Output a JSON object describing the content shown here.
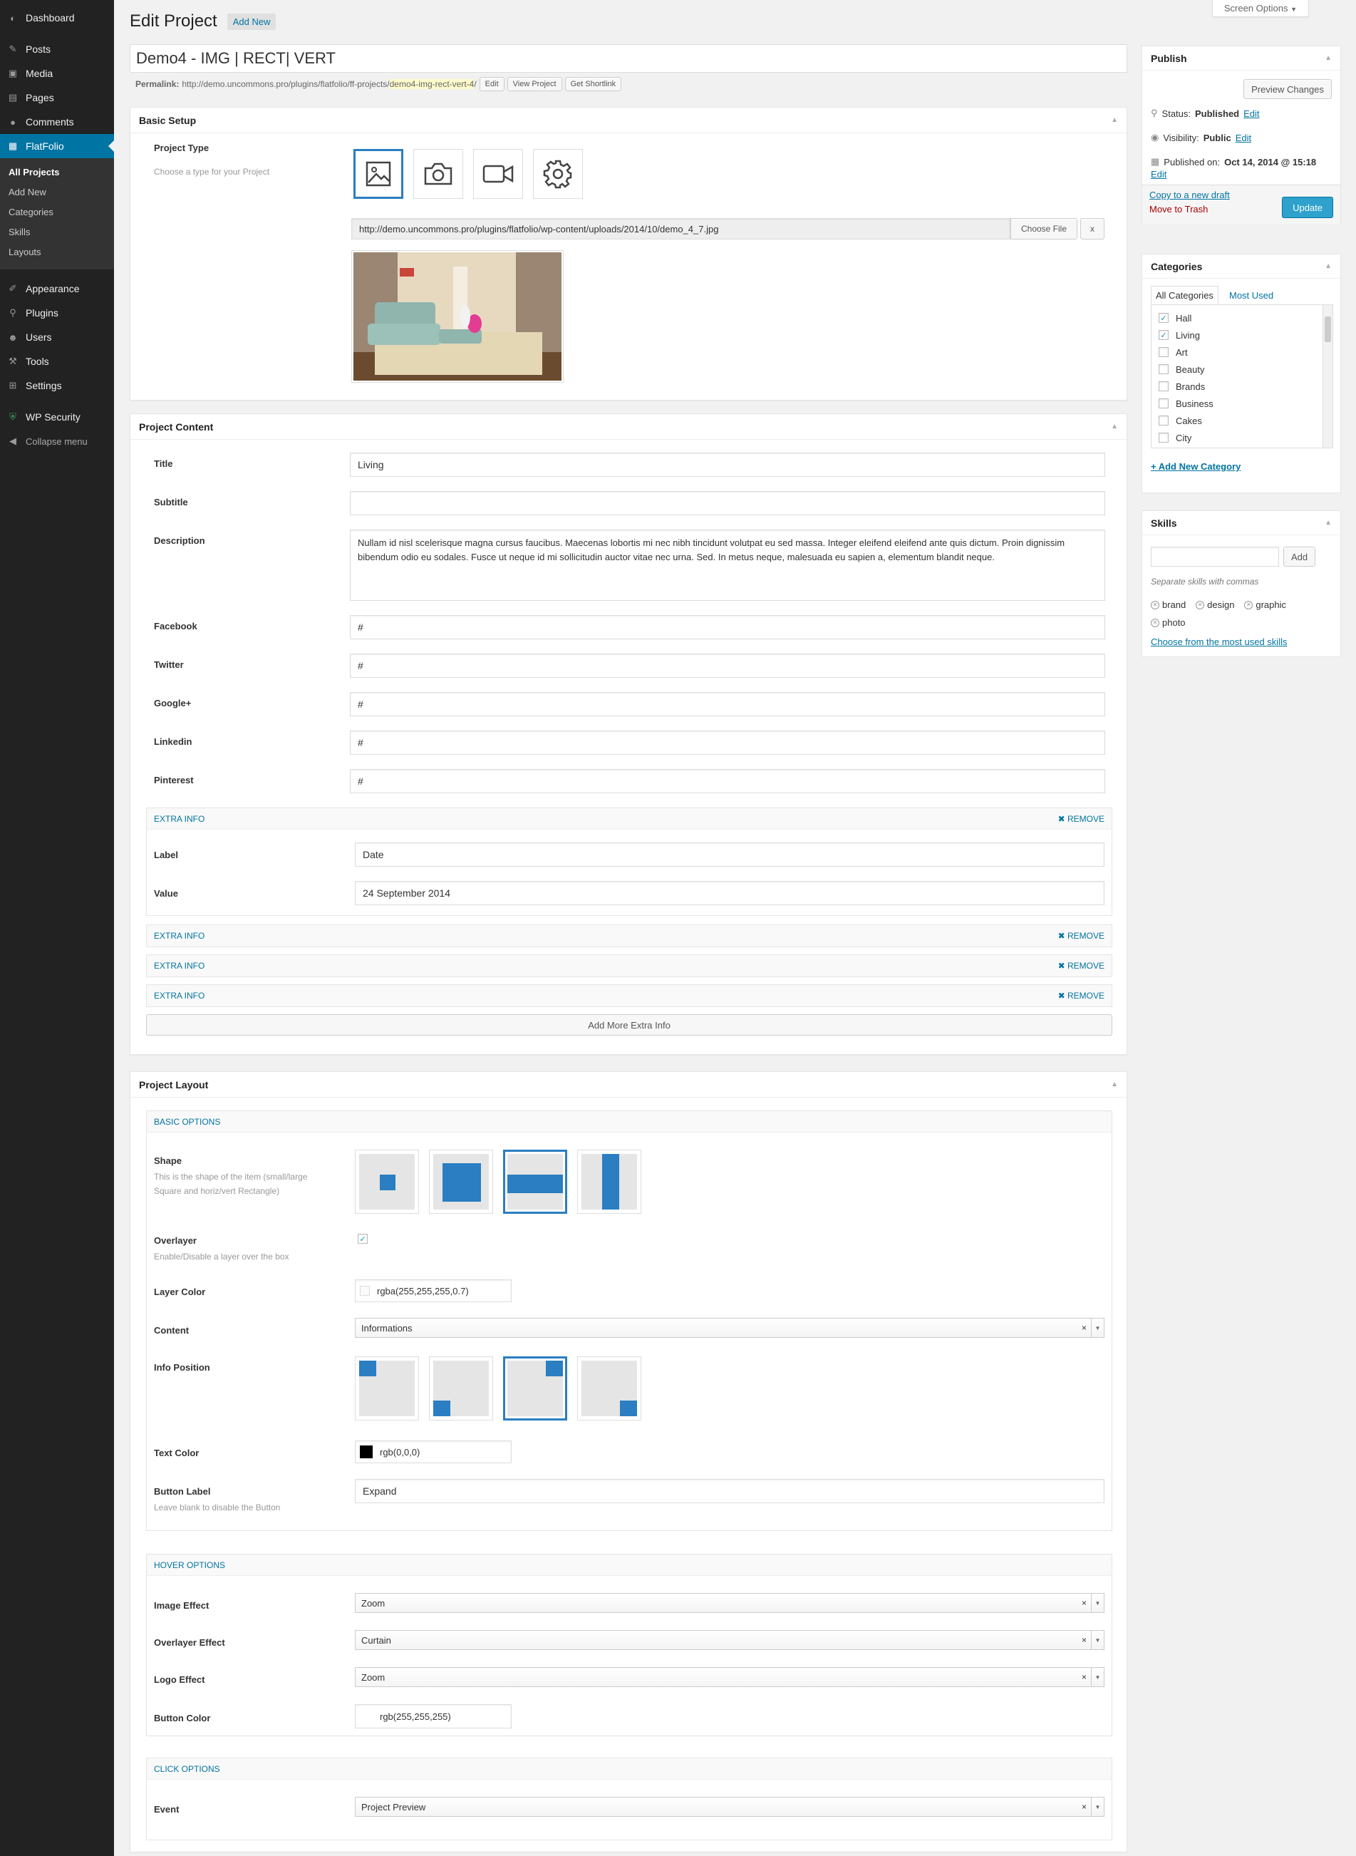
{
  "sidebar": {
    "top_items": [
      {
        "label": "Dashboard",
        "icon": "dashboard-icon"
      },
      {
        "label": "Posts",
        "icon": "pin-icon"
      },
      {
        "label": "Media",
        "icon": "media-icon"
      },
      {
        "label": "Pages",
        "icon": "page-icon"
      },
      {
        "label": "Comments",
        "icon": "comment-icon"
      },
      {
        "label": "FlatFolio",
        "icon": "flatfolio-icon"
      }
    ],
    "submenu": [
      "All Projects",
      "Add New",
      "Categories",
      "Skills",
      "Layouts"
    ],
    "bottom_items": [
      {
        "label": "Appearance",
        "icon": "brush-icon"
      },
      {
        "label": "Plugins",
        "icon": "plugin-icon"
      },
      {
        "label": "Users",
        "icon": "users-icon"
      },
      {
        "label": "Tools",
        "icon": "wrench-icon"
      },
      {
        "label": "Settings",
        "icon": "settings-icon"
      }
    ],
    "security": "WP Security",
    "collapse": "Collapse menu"
  },
  "header": {
    "screen_options": "Screen Options",
    "page_title": "Edit Project",
    "add_new": "Add New"
  },
  "post": {
    "title": "Demo4 - IMG | RECT| VERT",
    "permalink_label": "Permalink:",
    "permalink_base": "http://demo.uncommons.pro/plugins/flatfolio/ff-projects/",
    "permalink_slug": "demo4-img-rect-vert-4",
    "permalink_end": "/",
    "edit_btn": "Edit",
    "view_btn": "View Project",
    "shortlink_btn": "Get Shortlink"
  },
  "basic_setup": {
    "title": "Basic Setup",
    "project_type_label": "Project Type",
    "project_type_desc": "Choose a type for your Project",
    "file_url": "http://demo.uncommons.pro/plugins/flatfolio/wp-content/uploads/2014/10/demo_4_7.jpg",
    "choose_file": "Choose File",
    "clear": "x"
  },
  "project_content": {
    "title": "Project Content",
    "fields": [
      {
        "label": "Title",
        "value": "Living"
      },
      {
        "label": "Subtitle",
        "value": ""
      },
      {
        "label": "Description",
        "value": "Nullam id nisl scelerisque magna cursus faucibus. Maecenas lobortis mi nec nibh tincidunt volutpat eu sed massa. Integer eleifend eleifend ante quis dictum. Proin dignissim bibendum odio eu sodales. Fusce ut neque id mi sollicitudin auctor vitae nec urna. Sed. In metus neque, malesuada eu sapien a, elementum blandit neque."
      },
      {
        "label": "Facebook",
        "value": "#"
      },
      {
        "label": "Twitter",
        "value": "#"
      },
      {
        "label": "Google+",
        "value": "#"
      },
      {
        "label": "Linkedin",
        "value": "#"
      },
      {
        "label": "Pinterest",
        "value": "#"
      }
    ],
    "extra_info_title": "EXTRA INFO",
    "remove": "REMOVE",
    "extra_label": "Label",
    "extra_label_value": "Date",
    "extra_value": "Value",
    "extra_value_value": "24 September 2014",
    "add_more": "Add More Extra Info"
  },
  "project_layout": {
    "title": "Project Layout",
    "basic_options": "BASIC OPTIONS",
    "shape_label": "Shape",
    "shape_desc": "This is the shape of the item (small/large Square and horiz/vert Rectangle)",
    "overlayer_label": "Overlayer",
    "overlayer_desc": "Enable/Disable a layer over the box",
    "overlayer_checked": "✓",
    "layer_color_label": "Layer Color",
    "layer_color_value": "rgba(255,255,255,0.7)",
    "content_label": "Content",
    "content_value": "Informations",
    "info_position_label": "Info Position",
    "text_color_label": "Text Color",
    "text_color_value": "rgb(0,0,0)",
    "button_label_label": "Button Label",
    "button_label_desc": "Leave blank to disable the Button",
    "button_label_value": "Expand",
    "hover_options": "HOVER OPTIONS",
    "image_effect_label": "Image Effect",
    "image_effect_value": "Zoom",
    "overlayer_effect_label": "Overlayer Effect",
    "overlayer_effect_value": "Curtain",
    "logo_effect_label": "Logo Effect",
    "logo_effect_value": "Zoom",
    "button_color_label": "Button Color",
    "button_color_value": "rgb(255,255,255)",
    "click_options": "CLICK OPTIONS",
    "event_label": "Event",
    "event_value": "Project Preview",
    "select_clear": "×",
    "select_arrow": "▼"
  },
  "publish": {
    "title": "Publish",
    "preview": "Preview Changes",
    "status_label": "Status:",
    "status_value": "Published",
    "visibility_label": "Visibility:",
    "visibility_value": "Public",
    "published_label": "Published on:",
    "published_value": "Oct 14, 2014 @ 15:18",
    "edit": "Edit",
    "copy_draft": "Copy to a new draft",
    "trash": "Move to Trash",
    "update": "Update"
  },
  "categories": {
    "title": "Categories",
    "tab_all": "All Categories",
    "tab_used": "Most Used",
    "items": [
      {
        "name": "Hall",
        "checked": "✓"
      },
      {
        "name": "Living",
        "checked": "✓"
      },
      {
        "name": "Art",
        "checked": ""
      },
      {
        "name": "Beauty",
        "checked": ""
      },
      {
        "name": "Brands",
        "checked": ""
      },
      {
        "name": "Business",
        "checked": ""
      },
      {
        "name": "Cakes",
        "checked": ""
      },
      {
        "name": "City",
        "checked": ""
      }
    ],
    "add_new": "+ Add New Category"
  },
  "skills": {
    "title": "Skills",
    "add": "Add",
    "hint": "Separate skills with commas",
    "tags": [
      "brand",
      "design",
      "graphic",
      "photo"
    ],
    "choose": "Choose from the most used skills"
  },
  "colors": {
    "accent": "#0074a2",
    "selected": "#2a7ec1",
    "sidebar": "#222222",
    "update": "#2ea2cc",
    "trash": "#a00000"
  }
}
